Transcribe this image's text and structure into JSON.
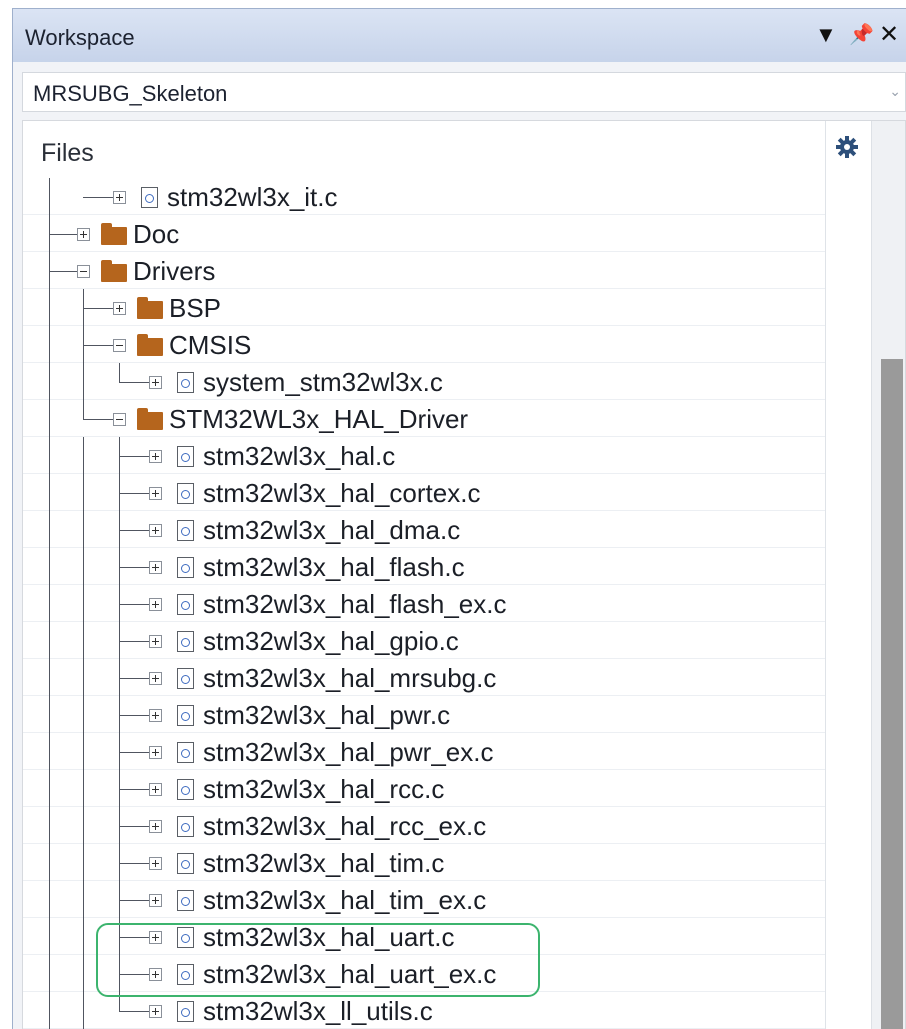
{
  "window": {
    "title": "Workspace",
    "controls": [
      "dropdown-arrow",
      "pin",
      "close"
    ]
  },
  "project_selector": {
    "selected": "MRSUBG_Skeleton"
  },
  "tree": {
    "header": "Files",
    "settings_icon": "gear-icon",
    "accent_colors": {
      "folder": "#b5651d",
      "highlight": "#3cb46e",
      "scroll_thumb": "#9a9a9a"
    },
    "items": [
      {
        "label": "stm32wl3x_it.c",
        "type": "file",
        "depth": 2,
        "expanded": false
      },
      {
        "label": "Doc",
        "type": "folder",
        "depth": 1,
        "expanded": false
      },
      {
        "label": "Drivers",
        "type": "folder",
        "depth": 1,
        "expanded": true
      },
      {
        "label": "BSP",
        "type": "folder",
        "depth": 2,
        "expanded": false
      },
      {
        "label": "CMSIS",
        "type": "folder",
        "depth": 2,
        "expanded": true
      },
      {
        "label": "system_stm32wl3x.c",
        "type": "file",
        "depth": 3,
        "expanded": false
      },
      {
        "label": "STM32WL3x_HAL_Driver",
        "type": "folder",
        "depth": 2,
        "expanded": true
      },
      {
        "label": "stm32wl3x_hal.c",
        "type": "file",
        "depth": 3,
        "expanded": false
      },
      {
        "label": "stm32wl3x_hal_cortex.c",
        "type": "file",
        "depth": 3,
        "expanded": false
      },
      {
        "label": "stm32wl3x_hal_dma.c",
        "type": "file",
        "depth": 3,
        "expanded": false
      },
      {
        "label": "stm32wl3x_hal_flash.c",
        "type": "file",
        "depth": 3,
        "expanded": false
      },
      {
        "label": "stm32wl3x_hal_flash_ex.c",
        "type": "file",
        "depth": 3,
        "expanded": false
      },
      {
        "label": "stm32wl3x_hal_gpio.c",
        "type": "file",
        "depth": 3,
        "expanded": false
      },
      {
        "label": "stm32wl3x_hal_mrsubg.c",
        "type": "file",
        "depth": 3,
        "expanded": false
      },
      {
        "label": "stm32wl3x_hal_pwr.c",
        "type": "file",
        "depth": 3,
        "expanded": false
      },
      {
        "label": "stm32wl3x_hal_pwr_ex.c",
        "type": "file",
        "depth": 3,
        "expanded": false
      },
      {
        "label": "stm32wl3x_hal_rcc.c",
        "type": "file",
        "depth": 3,
        "expanded": false
      },
      {
        "label": "stm32wl3x_hal_rcc_ex.c",
        "type": "file",
        "depth": 3,
        "expanded": false
      },
      {
        "label": "stm32wl3x_hal_tim.c",
        "type": "file",
        "depth": 3,
        "expanded": false
      },
      {
        "label": "stm32wl3x_hal_tim_ex.c",
        "type": "file",
        "depth": 3,
        "expanded": false
      },
      {
        "label": "stm32wl3x_hal_uart.c",
        "type": "file",
        "depth": 3,
        "expanded": false,
        "highlighted": true
      },
      {
        "label": "stm32wl3x_hal_uart_ex.c",
        "type": "file",
        "depth": 3,
        "expanded": false,
        "highlighted": true
      },
      {
        "label": "stm32wl3x_ll_utils.c",
        "type": "file",
        "depth": 3,
        "expanded": false
      }
    ]
  }
}
